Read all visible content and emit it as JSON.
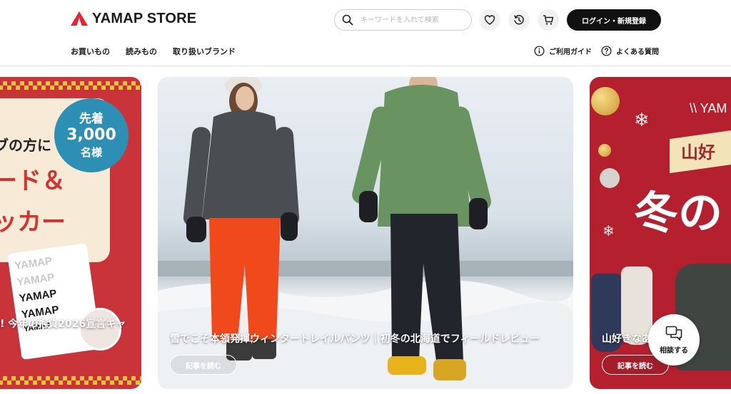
{
  "header": {
    "logo_text": "YAMAP STORE",
    "search_placeholder": "キーワードを入れて検索",
    "login_label": "ログイン・新規登録",
    "icons": [
      "heart-icon",
      "history-icon",
      "cart-icon",
      "search-icon"
    ]
  },
  "nav": {
    "items": [
      {
        "label": "お買いもの"
      },
      {
        "label": "読みもの"
      },
      {
        "label": "取り扱いブランド"
      }
    ],
    "guide_label": "ご利用ガイド",
    "faq_label": "よくある質問"
  },
  "carousel": {
    "left": {
      "title": "! 今年の抱負2026宣言キャ",
      "line1": "ブの方に",
      "line2": "ード＆",
      "line3": "ッカー",
      "badge_line1": "先着",
      "badge_line2": "3,000",
      "badge_line3": "名様",
      "sticker_labels": [
        "YAMAP",
        "YAMAP",
        "YAMAP",
        "YAMAP",
        "YAMAP"
      ]
    },
    "center": {
      "title": "雪でこそ本領発揮ウィンタートレイルパンツ｜初冬の北海道でフィールドレビュー",
      "button_label": "記事を読む"
    },
    "right": {
      "title": "山好きなあ",
      "button_label": "記事を読む",
      "top_text": "\\\\ YAM",
      "ribbon_text": "山好",
      "big_text": "冬の"
    }
  },
  "consult": {
    "label": "相談する"
  },
  "colors": {
    "brand_red": "#e5262f",
    "primary_dark": "#111111",
    "left_slide_bg": "#c9343a",
    "right_slide_bg": "#b5202e"
  }
}
